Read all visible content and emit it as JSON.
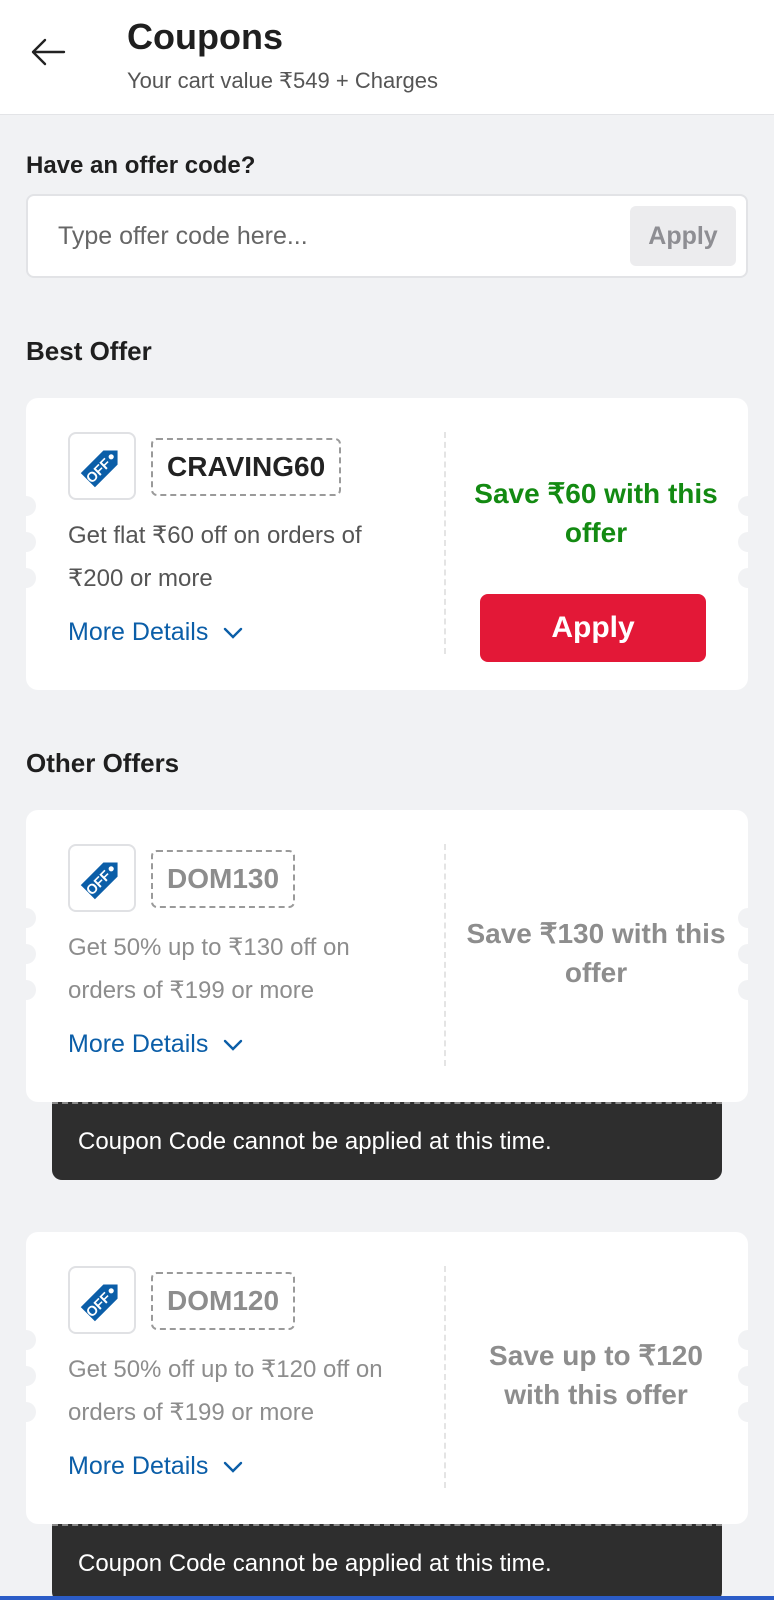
{
  "header": {
    "title": "Coupons",
    "subtitle": "Your cart value ₹549 + Charges"
  },
  "offer_code": {
    "heading": "Have an offer code?",
    "placeholder": "Type offer code here...",
    "apply_label": "Apply"
  },
  "best_offer": {
    "heading": "Best Offer",
    "code": "CRAVING60",
    "description": "Get flat ₹60 off on orders of ₹200 or more",
    "more_details": "More Details",
    "save_text": "Save ₹60 with this offer",
    "apply_label": "Apply",
    "icon_text": "OFF"
  },
  "other_offers": {
    "heading": "Other Offers",
    "items": [
      {
        "code": "DOM130",
        "description": "Get 50% up to ₹130 off on orders of ₹199 or more",
        "more_details": "More Details",
        "save_text": "Save ₹130 with this offer",
        "message": "Coupon Code cannot be applied at this time.",
        "icon_text": "OFF"
      },
      {
        "code": "DOM120",
        "description": "Get 50% off up to ₹120 off on orders of ₹199 or more",
        "more_details": "More Details",
        "save_text": "Save up to ₹120 with this offer",
        "message": "Coupon Code cannot be applied at this time.",
        "icon_text": "OFF"
      }
    ]
  },
  "colors": {
    "brand_blue": "#0b5ea8",
    "apply_red": "#e31837",
    "save_green": "#138a12"
  }
}
